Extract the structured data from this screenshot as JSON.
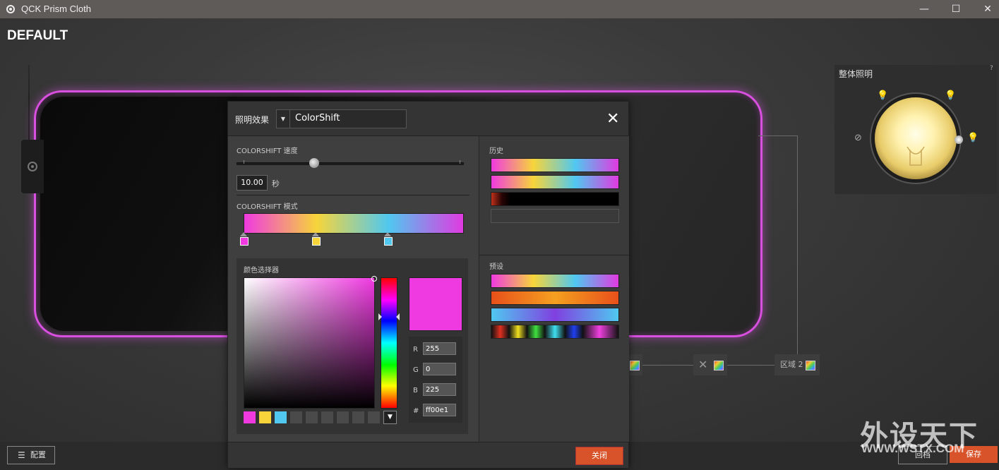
{
  "window": {
    "title": "QCK Prism Cloth",
    "minimize": "—",
    "maximize": "☐",
    "close": "✕"
  },
  "profile_name": "DEFAULT",
  "zones": {
    "zone2_label": "区域 2",
    "x_mark": "✕"
  },
  "global_lighting": {
    "title": "整体照明",
    "help": "?",
    "level": 1.0
  },
  "modal": {
    "effect_label": "照明效果",
    "effect_value": "ColorShift",
    "close_icon": "✕",
    "speed_label": "COLORSHIFT 速度",
    "speed_value": "10.00",
    "speed_unit": "秒",
    "pattern_label": "COLORSHIFT 模式",
    "picker_label": "颜色选择器",
    "rgb": {
      "r_label": "R",
      "r_value": "255",
      "g_label": "G",
      "g_value": "0",
      "b_label": "B",
      "b_value": "225",
      "hex_label": "#",
      "hex_value": "ff00e1"
    },
    "history_label": "历史",
    "presets_label": "预设",
    "close_button": "关闭"
  },
  "bottom": {
    "config_button": "配置",
    "revert_button": "回档",
    "save_button": "保存"
  },
  "watermark": {
    "cn": "外设天下",
    "en": "WWW.WSTX.COM"
  },
  "colors": {
    "accent": "#d9532a",
    "selected_color": "#f03ae1",
    "stop1": "#f03ae0",
    "stop2": "#f7d53a",
    "stop3": "#50c8f0"
  }
}
